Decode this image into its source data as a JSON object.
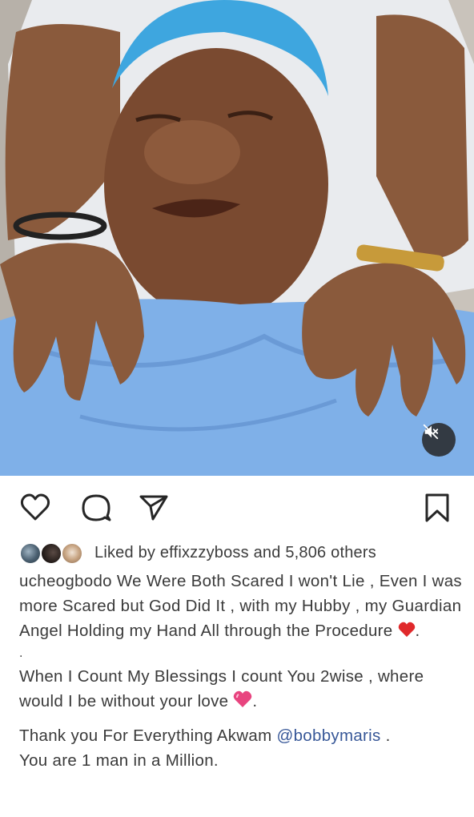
{
  "post": {
    "media": {
      "type": "video",
      "description_icon": "video-frame",
      "mute_icon": "muted-speaker-icon"
    },
    "actions": {
      "like_icon": "heart-icon",
      "comment_icon": "comment-icon",
      "share_icon": "send-icon",
      "save_icon": "bookmark-icon"
    },
    "likes": {
      "prefix": "Liked by",
      "user": "effixzzyboss",
      "suffix": "and 5,806 others"
    },
    "caption": {
      "username": "ucheogbodo",
      "line1_text": "We Were Both Scared I won't Lie , Even I was more Scared but God Did It , with my Hubby , my Guardian Angel Holding my Hand All through the Procedure",
      "line1_end": ".",
      "dot": ".",
      "line2_text": "When I Count My Blessings I count You 2wise , where would I be without your love",
      "line2_end": ".",
      "line3_text": "Thank you For Everything Akwam",
      "mention": "@bobbymaris",
      "line3_end": " .",
      "line4_text": "You are 1 man in a Million."
    },
    "colors": {
      "mention": "#385898",
      "red_heart": "#e0292b",
      "pink_heart": "#e8447f",
      "scrub_blue": "#7fb0e8",
      "cap_blue": "#3ea6df"
    }
  }
}
